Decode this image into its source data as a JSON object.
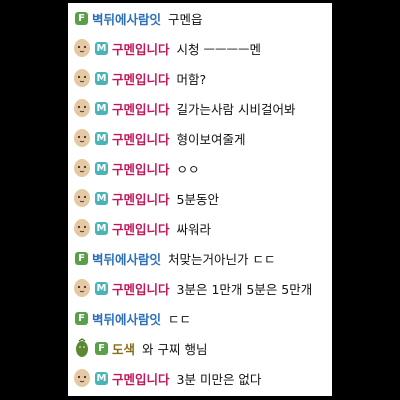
{
  "colors": {
    "badge_F": "#5aa04a",
    "badge_M": "#4ab3b3",
    "name_green": "#2b6fbd",
    "name_pink": "#c2185b",
    "name_olive": "#8a6d1a",
    "avatar_skin": "#e6c9a2",
    "avatar_green": "#5a8a2f"
  },
  "messages": [
    {
      "avatar": "",
      "badge": "F",
      "name": "벽뒤에사람잇",
      "text": "구멘읍"
    },
    {
      "avatar": "peanut-avatar",
      "badge": "M",
      "name": "구멘입니다",
      "text": "시청 ㅡㅡㅡㅡ멘"
    },
    {
      "avatar": "peanut-avatar",
      "badge": "M",
      "name": "구멘입니다",
      "text": "머함?"
    },
    {
      "avatar": "peanut-avatar",
      "badge": "M",
      "name": "구멘입니다",
      "text": "길가는사람 시비걸어봐"
    },
    {
      "avatar": "peanut-avatar",
      "badge": "M",
      "name": "구멘입니다",
      "text": "형이보여줄게"
    },
    {
      "avatar": "peanut-avatar",
      "badge": "M",
      "name": "구멘입니다",
      "text": "ㅇㅇ"
    },
    {
      "avatar": "peanut-avatar",
      "badge": "M",
      "name": "구멘입니다",
      "text": "5분동안"
    },
    {
      "avatar": "peanut-avatar",
      "badge": "M",
      "name": "구멘입니다",
      "text": "싸워라"
    },
    {
      "avatar": "",
      "badge": "F",
      "name": "벽뒤에사람잇",
      "text": "처맞는거아닌가 ㄷㄷ"
    },
    {
      "avatar": "peanut-avatar",
      "badge": "M",
      "name": "구멘입니다",
      "text": "3분은 1만개 5분은 5만개"
    },
    {
      "avatar": "",
      "badge": "F",
      "name": "벽뒤에사람잇",
      "text": "ㄷㄷ"
    },
    {
      "avatar": "cucumber-avatar",
      "badge": "F",
      "name": "도색",
      "text": "와 구찌 행님"
    },
    {
      "avatar": "peanut-avatar",
      "badge": "M",
      "name": "구멘입니다",
      "text": "3분 미만은 없다"
    }
  ]
}
